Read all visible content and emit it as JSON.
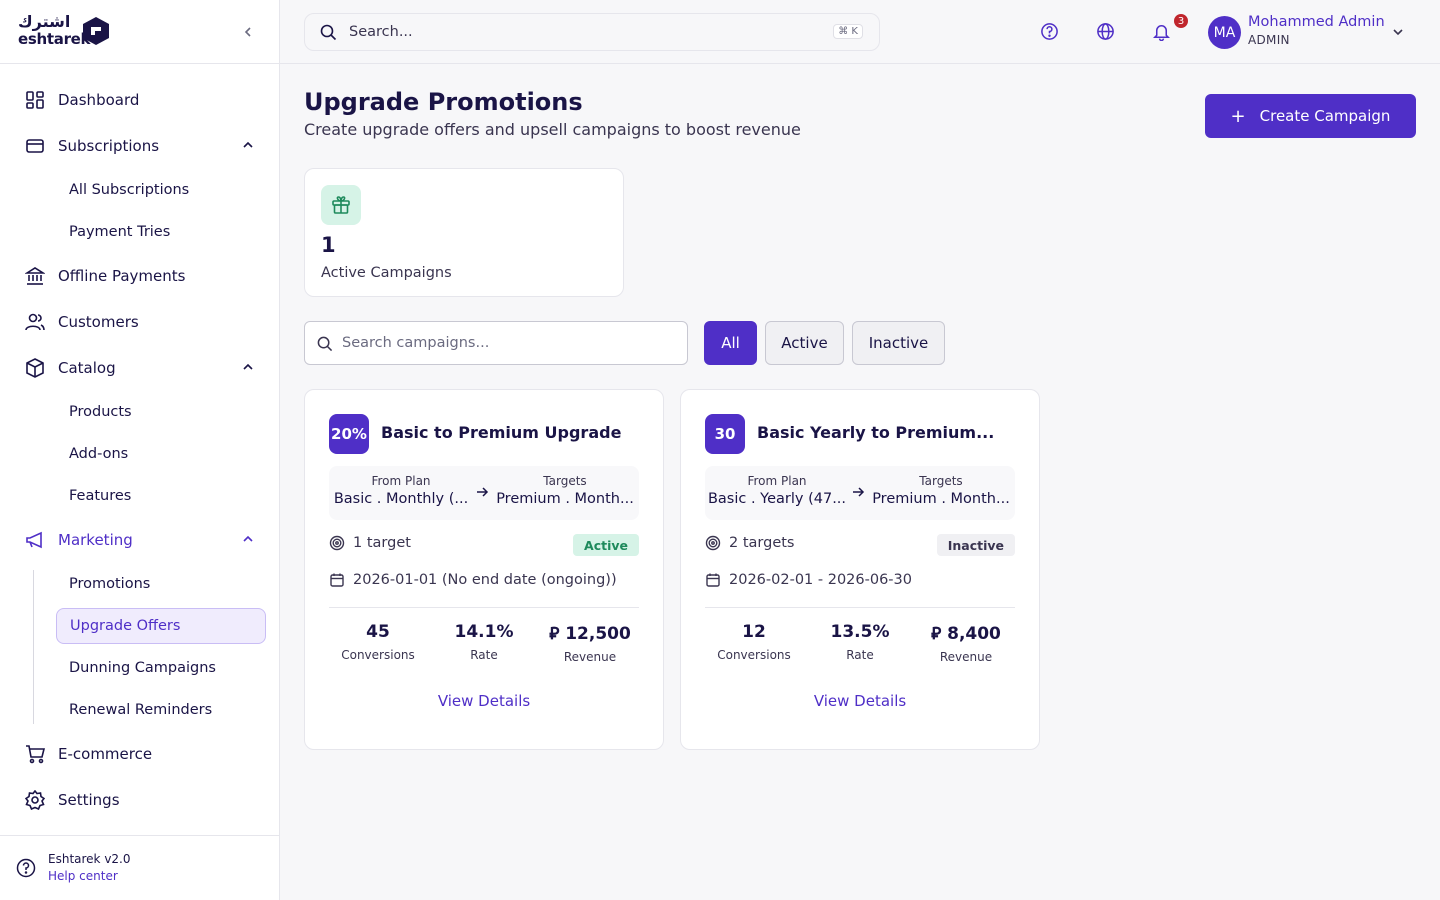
{
  "brand": {
    "name_en": "eshtarek",
    "name_ar": "اشترك",
    "accent": "#4f2fc7"
  },
  "sidebar": {
    "items": [
      {
        "label": "Dashboard"
      },
      {
        "label": "Subscriptions"
      },
      {
        "label": "All Subscriptions"
      },
      {
        "label": "Payment Tries"
      },
      {
        "label": "Offline Payments"
      },
      {
        "label": "Customers"
      },
      {
        "label": "Catalog"
      },
      {
        "label": "Products"
      },
      {
        "label": "Add-ons"
      },
      {
        "label": "Features"
      },
      {
        "label": "Marketing"
      },
      {
        "label": "Promotions"
      },
      {
        "label": "Upgrade Offers"
      },
      {
        "label": "Dunning Campaigns"
      },
      {
        "label": "Renewal Reminders"
      },
      {
        "label": "E-commerce"
      },
      {
        "label": "Settings"
      }
    ],
    "footer": {
      "version": "Eshtarek v2.0",
      "help": "Help center"
    }
  },
  "topbar": {
    "search_placeholder": "Search...",
    "shortcut": "⌘ K",
    "notifications_count": "3",
    "user": {
      "initials": "MA",
      "name": "Mohammed Admin",
      "role": "ADMIN"
    }
  },
  "page": {
    "title": "Upgrade Promotions",
    "subtitle": "Create upgrade offers and upsell campaigns to boost revenue",
    "create_label": "Create Campaign"
  },
  "stats": {
    "value": "1",
    "label": "Active Campaigns"
  },
  "filters": {
    "search_placeholder": "Search campaigns...",
    "options": [
      "All",
      "Active",
      "Inactive"
    ]
  },
  "campaigns": [
    {
      "badge": "20%",
      "title": "Basic to Premium Upgrade",
      "from_caption": "From Plan",
      "from": "Basic . Monthly (...",
      "to_caption": "Targets",
      "to": "Premium . Month...",
      "targets": "1 target",
      "status": "Active",
      "dates": "2026-01-01 (No end date (ongoing))",
      "metrics": [
        {
          "value": "45",
          "label": "Conversions"
        },
        {
          "value": "14.1%",
          "label": "Rate"
        },
        {
          "value": "⃁ 12,500",
          "label": "Revenue"
        }
      ],
      "link": "View Details"
    },
    {
      "badge": "30",
      "title": "Basic Yearly to Premium...",
      "from_caption": "From Plan",
      "from": "Basic . Yearly (47...",
      "to_caption": "Targets",
      "to": "Premium . Month...",
      "targets": "2 targets",
      "status": "Inactive",
      "dates": "2026-02-01 - 2026-06-30",
      "metrics": [
        {
          "value": "12",
          "label": "Conversions"
        },
        {
          "value": "13.5%",
          "label": "Rate"
        },
        {
          "value": "⃁ 8,400",
          "label": "Revenue"
        }
      ],
      "link": "View Details"
    }
  ]
}
